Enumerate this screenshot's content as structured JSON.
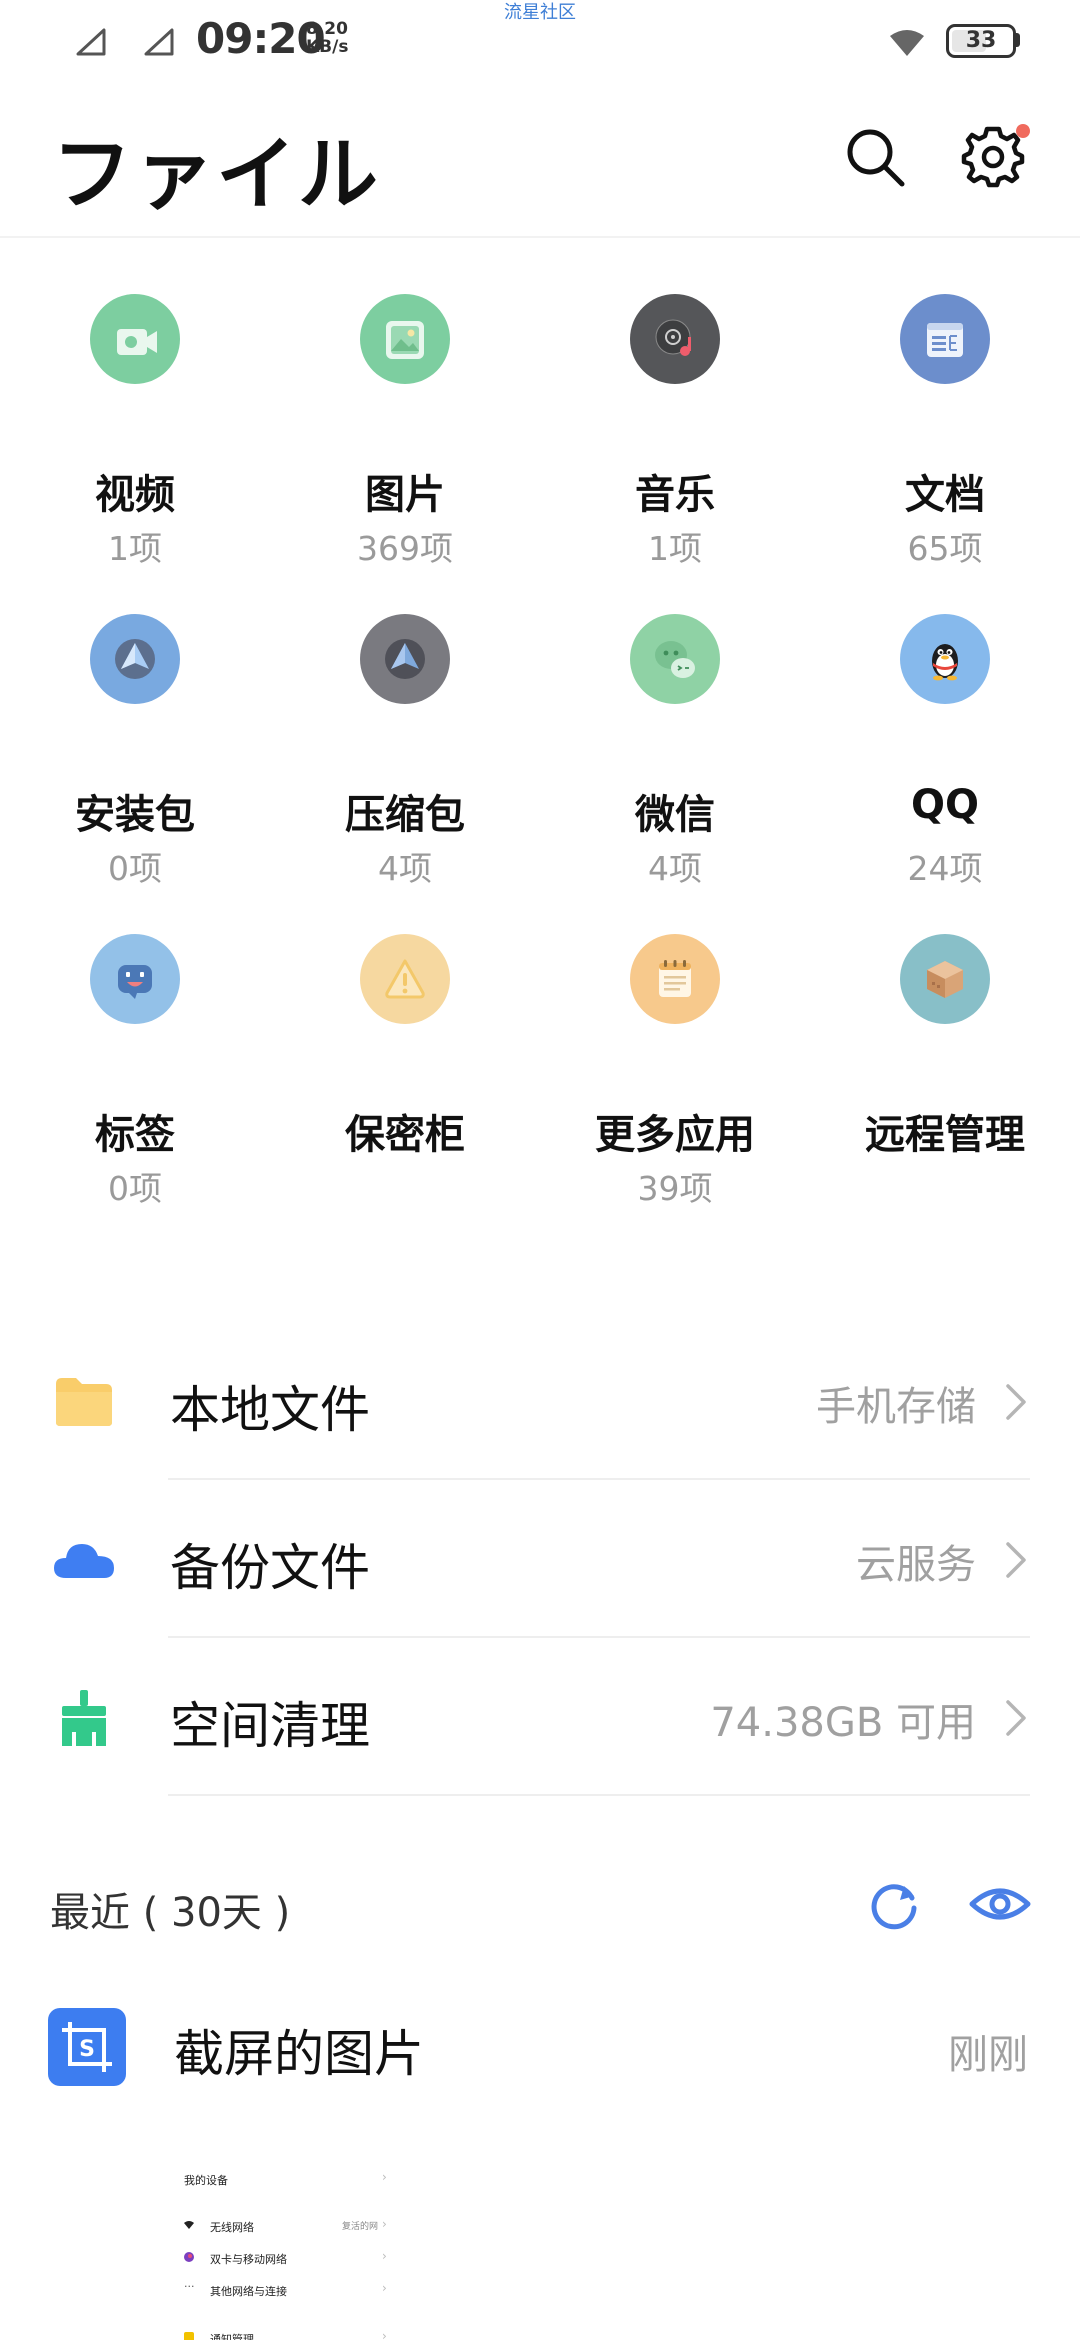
{
  "watermark": "流星社区",
  "status_bar": {
    "time": "09:20",
    "net_speed_value": "8.20",
    "net_speed_unit": "KB/s",
    "battery": "33"
  },
  "header": {
    "title": "ファイル",
    "icons": {
      "search": "search-icon",
      "settings": "gear-icon"
    }
  },
  "categories": [
    {
      "label": "视频",
      "count": "1项",
      "icon": "video-icon",
      "color": "#7dcea0"
    },
    {
      "label": "图片",
      "count": "369项",
      "icon": "image-icon",
      "color": "#7dcea0"
    },
    {
      "label": "音乐",
      "count": "1项",
      "icon": "music-disc-icon",
      "color": "#555659"
    },
    {
      "label": "文档",
      "count": "65项",
      "icon": "document-icon",
      "color": "#6c8ecc"
    },
    {
      "label": "安装包",
      "count": "0项",
      "icon": "package-icon",
      "color": "#79a9e0"
    },
    {
      "label": "压缩包",
      "count": "4项",
      "icon": "archive-icon",
      "color": "#7a7a80"
    },
    {
      "label": "微信",
      "count": "4项",
      "icon": "wechat-icon",
      "color": "#8fd2a5"
    },
    {
      "label": "QQ",
      "count": "24项",
      "icon": "qq-penguin-icon",
      "color": "#86b9ec"
    },
    {
      "label": "标签",
      "count": "0项",
      "icon": "tag-face-icon",
      "color": "#93c1e8"
    },
    {
      "label": "保密柜",
      "count": "",
      "icon": "safe-warning-icon",
      "color": "#f6d8a0"
    },
    {
      "label": "更多应用",
      "count": "39项",
      "icon": "notepad-icon",
      "color": "#f7c98c"
    },
    {
      "label": "远程管理",
      "count": "",
      "icon": "box-icon",
      "color": "#88bfc8"
    }
  ],
  "rows": [
    {
      "title": "本地文件",
      "value": "手机存储",
      "icon": "folder-icon",
      "color": "#f9cd6a"
    },
    {
      "title": "备份文件",
      "value": "云服务",
      "icon": "cloud-icon",
      "color": "#3f7ef2"
    },
    {
      "title": "空间清理",
      "value": "74.38GB 可用",
      "icon": "broom-icon",
      "color": "#33c98b"
    }
  ],
  "recent": {
    "title": "最近 ( 30天 )",
    "refresh_icon": "refresh-icon",
    "eye_icon": "eye-icon",
    "accent": "#4a7fe6"
  },
  "screenshot_item": {
    "title": "截屏的图片",
    "time": "刚刚",
    "icon": "screenshot-crop-icon"
  },
  "thumbnail": {
    "header": "我的设备",
    "items": [
      {
        "label": "无线网络",
        "value": "复活的网"
      },
      {
        "label": "双卡与移动网络",
        "value": ""
      },
      {
        "label": "其他网络与连接",
        "value": ""
      },
      {
        "label": "通知管理",
        "value": ""
      }
    ]
  }
}
